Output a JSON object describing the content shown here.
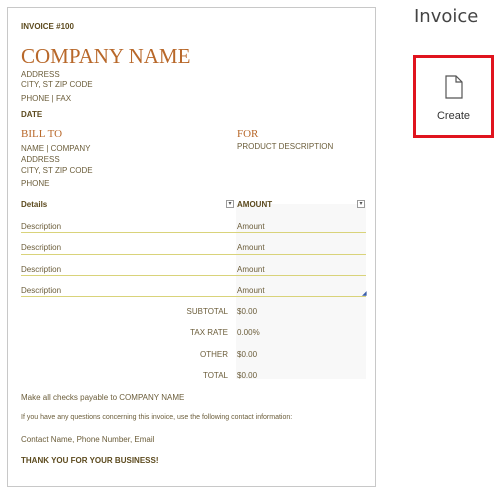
{
  "invoice": {
    "number": "INVOICE #100",
    "company_name": "COMPANY NAME",
    "address": "ADDRESS",
    "city": "CITY, ST ZIP CODE",
    "phone_fax": "PHONE | FAX",
    "date": "DATE",
    "bill_to_heading": "BILL TO",
    "bill_to_lines": [
      "NAME | COMPANY",
      "ADDRESS",
      "CITY, ST ZIP CODE",
      "PHONE"
    ],
    "for_heading": "FOR",
    "for_text": "PRODUCT DESCRIPTION",
    "table": {
      "col_details": "Details",
      "col_amount": "AMOUNT",
      "rows": [
        {
          "description": "Description",
          "amount": "Amount"
        },
        {
          "description": "Description",
          "amount": "Amount"
        },
        {
          "description": "Description",
          "amount": "Amount"
        },
        {
          "description": "Description",
          "amount": "Amount"
        }
      ]
    },
    "totals": [
      {
        "label": "SUBTOTAL",
        "value": "$0.00"
      },
      {
        "label": "TAX RATE",
        "value": "0.00%"
      },
      {
        "label": "OTHER",
        "value": "$0.00"
      },
      {
        "label": "TOTAL",
        "value": "$0.00"
      }
    ],
    "checks_note": "Make all checks payable to COMPANY NAME",
    "questions_note": "If you have any questions concerning this invoice, use the following contact information:",
    "contact": "Contact Name, Phone Number, Email",
    "thanks": "THANK YOU FOR YOUR BUSINESS!"
  },
  "panel": {
    "title": "Invoice",
    "create_label": "Create",
    "create_icon": "document-icon",
    "accent_color": "#e0141e"
  }
}
